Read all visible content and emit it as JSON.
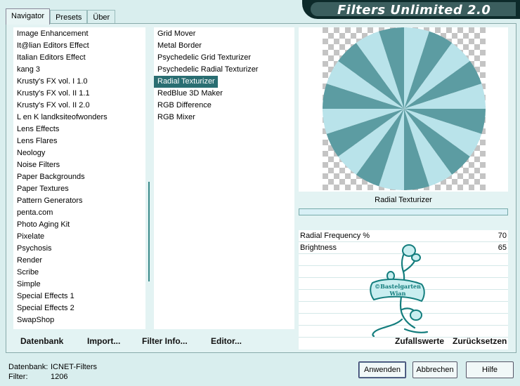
{
  "tabs": [
    {
      "label": "Navigator",
      "active": true
    },
    {
      "label": "Presets",
      "active": false
    },
    {
      "label": "Über",
      "active": false
    }
  ],
  "banner": {
    "title": "Filters Unlimited 2.0"
  },
  "categories": [
    "Image Enhancement",
    "It@lian Editors Effect",
    "Italian Editors Effect",
    "kang 3",
    "Krusty's FX vol. I 1.0",
    "Krusty's FX vol. II 1.1",
    "Krusty's FX vol. II 2.0",
    "L en K landksiteofwonders",
    "Lens Effects",
    "Lens Flares",
    "Neology",
    "Noise Filters",
    "Paper Backgrounds",
    "Paper Textures",
    "Pattern Generators",
    "penta.com",
    "Photo Aging Kit",
    "Pixelate",
    "Psychosis",
    "Render",
    "Scribe",
    "Simple",
    "Special Effects 1",
    "Special Effects 2",
    "SwapShop"
  ],
  "filters": [
    {
      "label": "Grid Mover",
      "selected": false
    },
    {
      "label": "Metal Border",
      "selected": false
    },
    {
      "label": "Psychedelic Grid Texturizer",
      "selected": false
    },
    {
      "label": "Psychedelic Radial Texturizer",
      "selected": false
    },
    {
      "label": "Radial Texturizer",
      "selected": true
    },
    {
      "label": "RedBlue 3D Maker",
      "selected": false
    },
    {
      "label": "RGB Difference",
      "selected": false
    },
    {
      "label": "RGB Mixer",
      "selected": false
    }
  ],
  "preview": {
    "filter_name": "Radial Texturizer",
    "color_light": "#b9e3ea",
    "color_dark": "#5c9ca2"
  },
  "params": [
    {
      "label": "Radial Frequency %",
      "value": "70"
    },
    {
      "label": "Brightness",
      "value": "65"
    }
  ],
  "watermark": {
    "line1": "©Bastelgarten",
    "line2": "Wian"
  },
  "bottom_links": {
    "datenbank": "Datenbank",
    "import": "Import...",
    "filter_info": "Filter Info...",
    "editor": "Editor...",
    "zufallswerte": "Zufallswerte",
    "zuruecksetzen": "Zurücksetzen"
  },
  "footer": {
    "db_label": "Datenbank:",
    "db_value": "ICNET-Filters",
    "filter_label": "Filter:",
    "filter_value": "1206"
  },
  "buttons": {
    "apply": "Anwenden",
    "cancel": "Abbrechen",
    "help": "Hilfe"
  }
}
